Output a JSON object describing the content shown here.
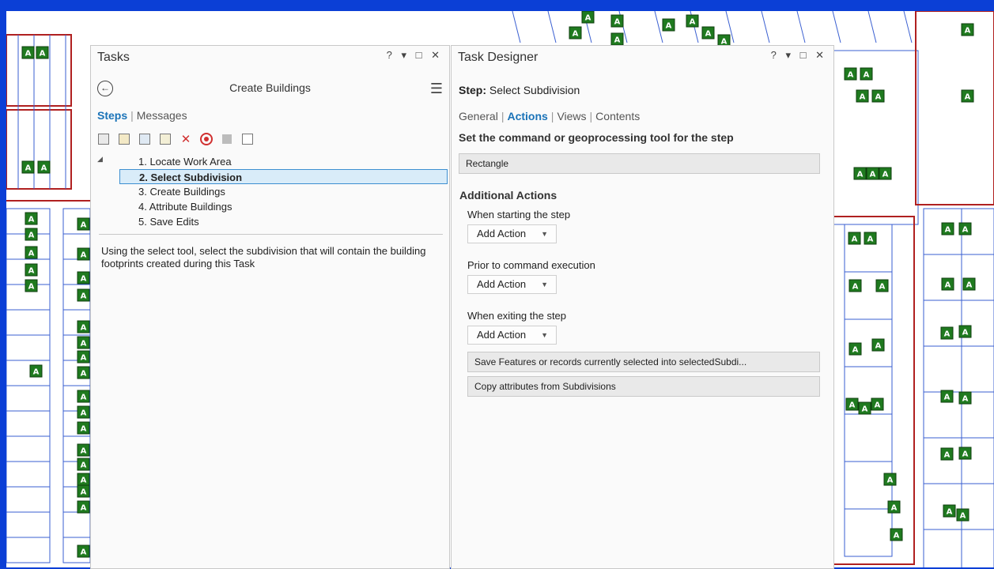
{
  "tasks_panel": {
    "title": "Tasks",
    "controls": [
      "?",
      "▾",
      "□",
      "✕"
    ],
    "task_name": "Create Buildings",
    "tabs": [
      {
        "label": "Steps",
        "active": true
      },
      {
        "label": "Messages",
        "active": false
      }
    ],
    "steps": [
      {
        "label": "1.  Locate Work Area",
        "selected": false
      },
      {
        "label": "2.  Select Subdivision",
        "selected": true
      },
      {
        "label": "3.  Create Buildings",
        "selected": false
      },
      {
        "label": "4.  Attribute Buildings",
        "selected": false
      },
      {
        "label": "5.  Save Edits",
        "selected": false
      }
    ],
    "description": "Using the select tool, select the subdivision that will contain the building footprints created during this Task"
  },
  "designer_panel": {
    "title": "Task Designer",
    "controls": [
      "?",
      "▾",
      "□",
      "✕"
    ],
    "step_prefix": "Step:",
    "step_name": "Select Subdivision",
    "tabs": [
      {
        "label": "General",
        "active": false
      },
      {
        "label": "Actions",
        "active": true
      },
      {
        "label": "Views",
        "active": false
      },
      {
        "label": "Contents",
        "active": false
      }
    ],
    "command_heading": "Set the command or geoprocessing tool for the step",
    "command_value": "Rectangle",
    "additional_heading": "Additional Actions",
    "starting_label": "When starting the step",
    "prior_label": "Prior to command execution",
    "exiting_label": "When exiting the step",
    "add_action_label": "Add Action",
    "exit_actions": [
      "Save Features or records currently selected into selectedSubdi...",
      "Copy attributes from Subdivisions"
    ]
  },
  "map": {
    "building_marker": "A",
    "colors": {
      "frame": "#0b3fd6",
      "building": "#1f7a1f",
      "parcel": "#3a5fd1",
      "subdivision": "#b02020"
    }
  }
}
